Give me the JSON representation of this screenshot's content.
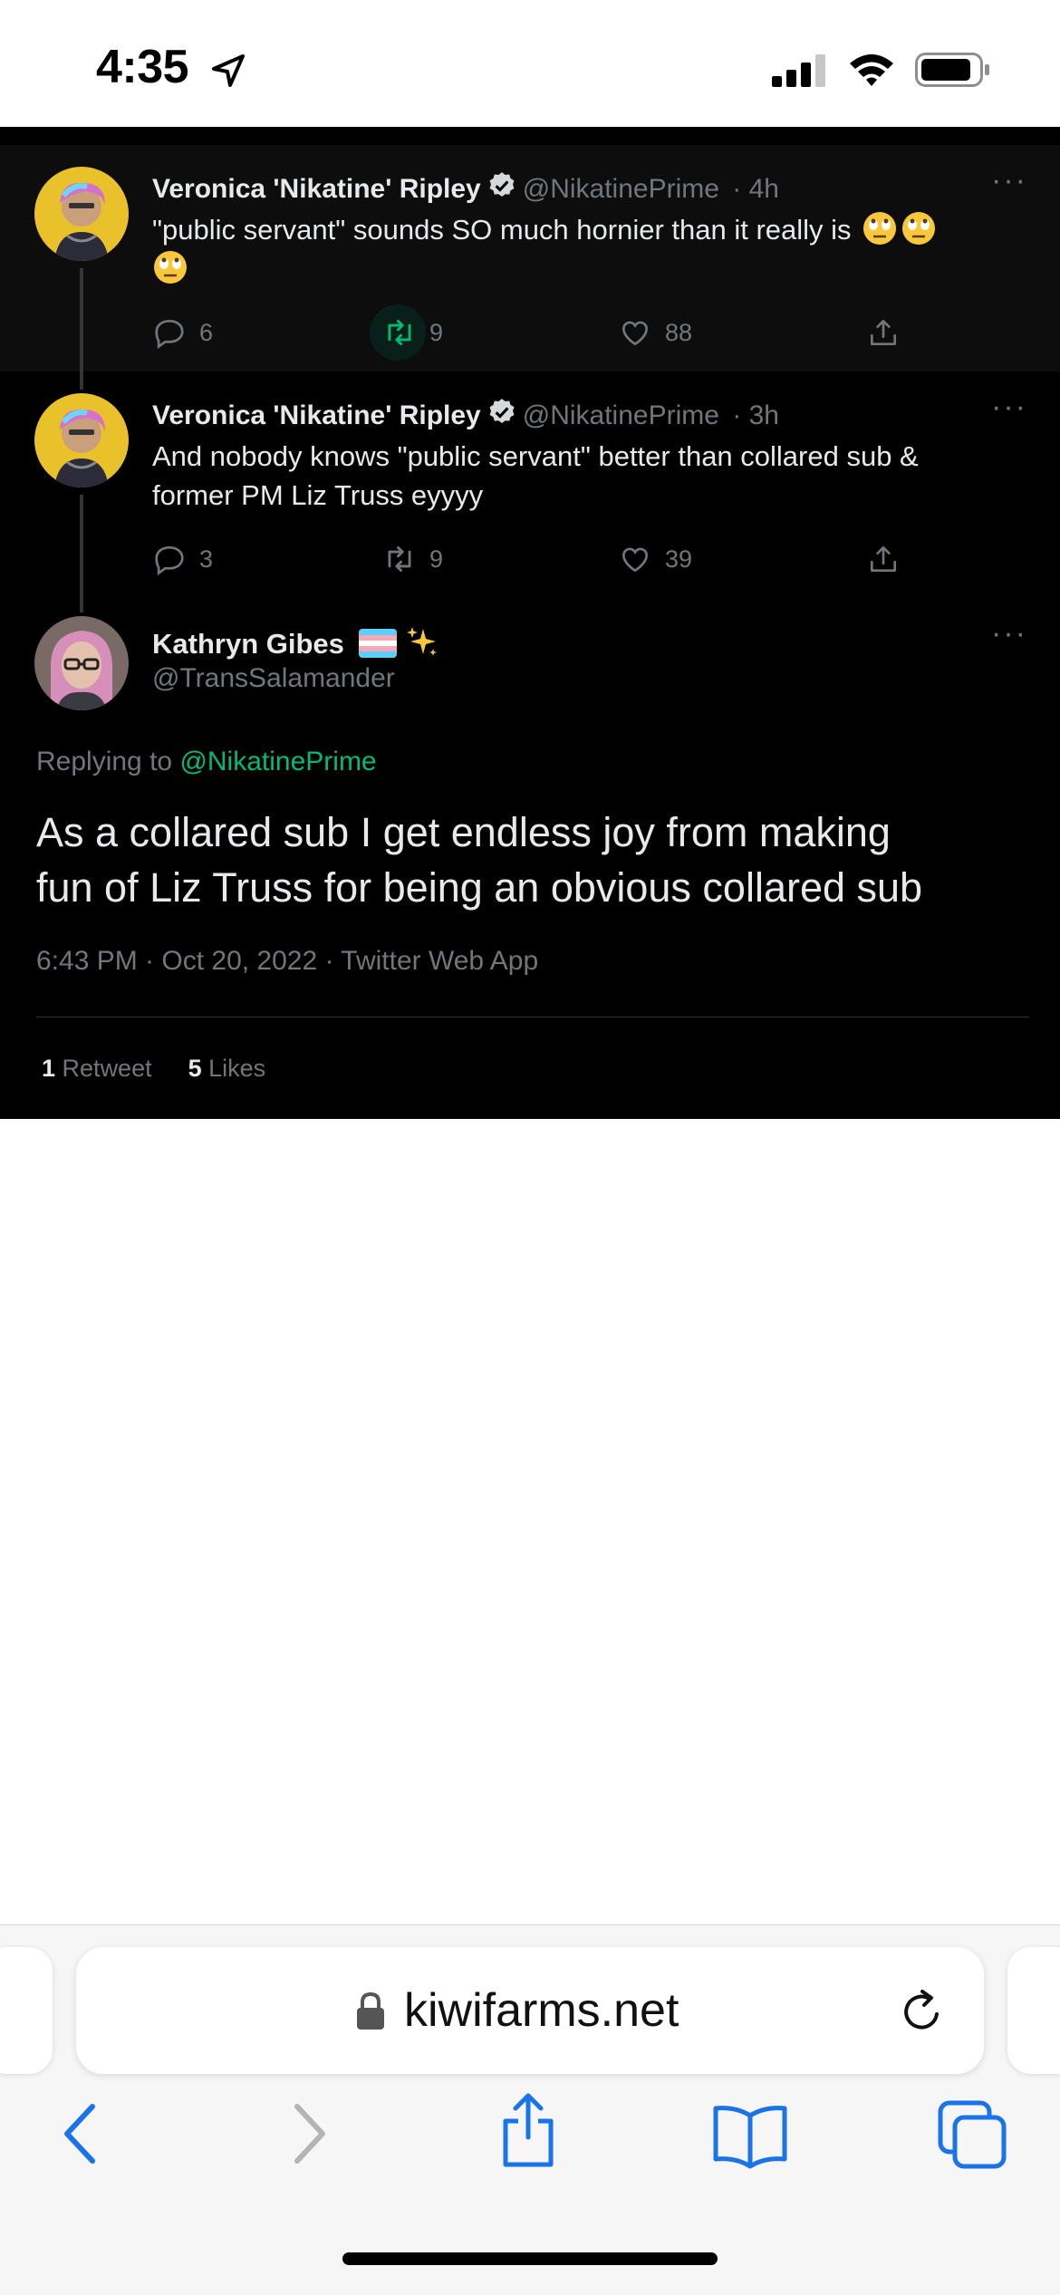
{
  "status_bar": {
    "time": "4:35"
  },
  "tweets": [
    {
      "name": "Veronica 'Nikatine' Ripley",
      "handle": "@NikatinePrime",
      "time": "· 4h",
      "more": "···",
      "text": "\"public servant\" sounds SO much hornier than it really is",
      "emoji_trailing": [
        "face-with-rolling-eyes",
        "face-with-rolling-eyes",
        "face-with-rolling-eyes"
      ],
      "replies": "6",
      "retweets": "9",
      "likes": "88"
    },
    {
      "name": "Veronica 'Nikatine' Ripley",
      "handle": "@NikatinePrime",
      "time": "· 3h",
      "more": "···",
      "text_line1": "And nobody knows \"public servant\" better than collared sub &",
      "text_line2": "former PM Liz Truss eyyyy",
      "replies": "3",
      "retweets": "9",
      "likes": "39"
    }
  ],
  "main_tweet": {
    "name": "Kathryn Gibes",
    "name_emoji": [
      "transgender-flag",
      "sparkles"
    ],
    "handle": "@TransSalamander",
    "more": "···",
    "replying_label": "Replying to",
    "replying_to": "@NikatinePrime",
    "text_line1": "As a collared sub I get endless joy from making",
    "text_line2": "fun of Liz Truss for being an obvious collared sub",
    "timestamp": "6:43 PM · Oct 20, 2022 · Twitter Web App",
    "retweet_count": "1",
    "retweet_label": "Retweet",
    "like_count": "5",
    "like_label": "Likes"
  },
  "browser": {
    "url": "kiwifarms.net",
    "icons": [
      "lock-icon",
      "reload-icon",
      "back-icon",
      "forward-icon",
      "share-icon",
      "bookmarks-icon",
      "tabs-icon"
    ]
  },
  "colors": {
    "tweet_bg": "#000000",
    "text_primary": "#e7e9ea",
    "text_secondary": "#71767b",
    "mention": "#00ba7c",
    "ios_blue": "#1a73e8"
  }
}
